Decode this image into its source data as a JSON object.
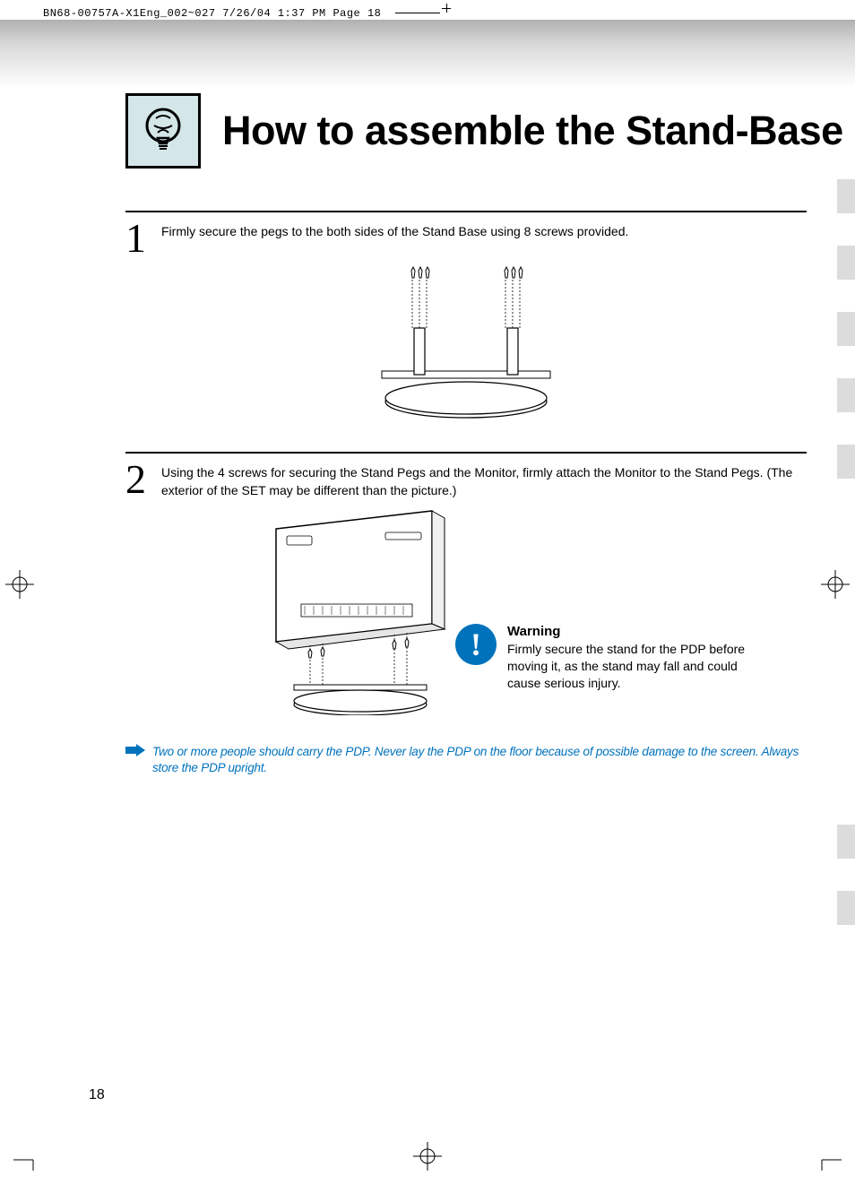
{
  "prepress": {
    "label": "BN68-00757A-X1Eng_002~027  7/26/04  1:37 PM  Page 18"
  },
  "title": "How to assemble the Stand-Base",
  "steps": [
    {
      "num": "1",
      "text": "Firmly secure the pegs to the both sides of the Stand Base using 8 screws provided."
    },
    {
      "num": "2",
      "text": "Using the 4 screws for securing the Stand Pegs and the Monitor, firmly attach the Monitor to the Stand Pegs. (The exterior of the SET may be different than the picture.)"
    }
  ],
  "warning": {
    "heading": "Warning",
    "body": "Firmly secure the stand for the PDP before moving it, as the stand may fall and could cause serious injury."
  },
  "note": "Two or more people should carry the PDP. Never lay the PDP on the floor because of possible damage to the screen. Always store the PDP upright.",
  "page_number": "18",
  "colors": {
    "accent": "#0072bc",
    "icon_bg": "#d4e6e8"
  }
}
